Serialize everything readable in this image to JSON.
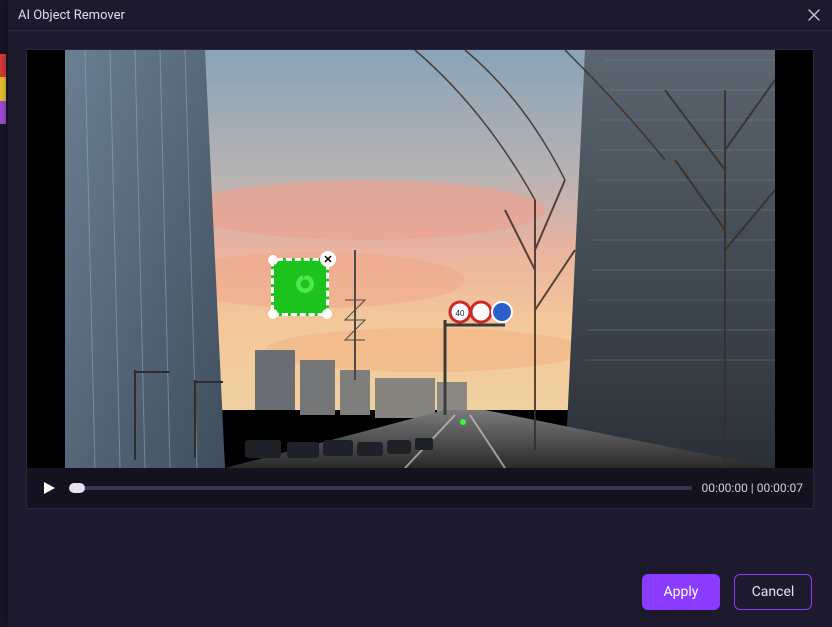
{
  "window": {
    "title": "AI Object Remover",
    "close_icon": "close-icon"
  },
  "selection": {
    "icon": "rotate-icon",
    "close_icon": "remove-selection-icon"
  },
  "transport": {
    "play_icon": "play-icon",
    "current_time": "00:00:00",
    "separator": " | ",
    "total_time": "00:00:07"
  },
  "footer": {
    "apply_label": "Apply",
    "cancel_label": "Cancel"
  }
}
